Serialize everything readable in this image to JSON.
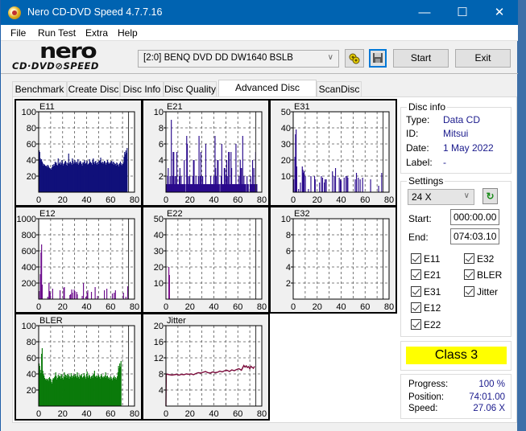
{
  "window": {
    "title": "Nero CD-DVD Speed 4.7.7.16",
    "controls": {
      "minimize": "—",
      "maximize": "☐",
      "close": "✕"
    }
  },
  "menu": [
    "File",
    "Run Test",
    "Extra",
    "Help"
  ],
  "toolbar": {
    "logo_top": "nero",
    "logo_bottom": "CD·DVD⊘SPEED",
    "drive": "[2:0]   BENQ DVD DD DW1640 BSLB",
    "start_label": "Start",
    "exit_label": "Exit"
  },
  "tabs": [
    {
      "label": "Benchmark",
      "active": false
    },
    {
      "label": "Create Disc",
      "active": false
    },
    {
      "label": "Disc Info",
      "active": false
    },
    {
      "label": "Disc Quality",
      "active": false
    },
    {
      "label": "Advanced Disc Quality",
      "active": true
    },
    {
      "label": "ScanDisc",
      "active": false
    }
  ],
  "disc_info": {
    "heading": "Disc info",
    "rows": [
      {
        "label": "Type:",
        "value": "Data CD"
      },
      {
        "label": "ID:",
        "value": "Mitsui"
      },
      {
        "label": "Date:",
        "value": "1 May 2022"
      },
      {
        "label": "Label:",
        "value": "-"
      }
    ]
  },
  "settings": {
    "heading": "Settings",
    "speed": "24 X",
    "start_label": "Start:",
    "start_value": "000:00.00",
    "end_label": "End:",
    "end_value": "074:03.10",
    "checkboxes": [
      {
        "label": "E11",
        "checked": true
      },
      {
        "label": "E32",
        "checked": true
      },
      {
        "label": "E21",
        "checked": true
      },
      {
        "label": "BLER",
        "checked": true
      },
      {
        "label": "E31",
        "checked": true
      },
      {
        "label": "Jitter",
        "checked": true
      },
      {
        "label": "E12",
        "checked": true
      },
      {
        "label": "E22",
        "checked": true
      }
    ]
  },
  "result": {
    "class_label": "Class 3",
    "class_color": "#ffff00"
  },
  "status": {
    "progress_label": "Progress:",
    "progress_value": "100 %",
    "position_label": "Position:",
    "position_value": "74:01.00",
    "speed_label": "Speed:",
    "speed_value": "27.06 X"
  },
  "chart_data": [
    {
      "name": "E11",
      "type": "bar",
      "color": "#10107a",
      "ylim": [
        0,
        100
      ],
      "yticks": [
        20,
        40,
        60,
        80,
        100
      ],
      "xlim": [
        0,
        80
      ],
      "xticks": [
        0,
        20,
        40,
        60,
        80
      ],
      "end_marker": 75,
      "values": [
        52,
        50,
        42,
        40,
        41,
        38,
        36,
        33,
        35,
        34,
        33,
        32,
        33,
        31,
        34,
        33,
        31,
        30,
        29,
        30,
        28,
        31,
        34,
        32,
        35,
        33,
        38,
        36,
        37,
        34,
        33,
        42,
        35,
        36,
        38,
        34,
        36,
        40,
        37,
        33,
        35,
        36,
        38,
        39,
        34,
        37,
        33,
        36,
        48,
        35,
        37,
        38,
        36,
        34,
        42,
        39,
        35,
        37,
        40,
        36,
        38,
        37,
        35,
        41,
        34,
        36,
        38,
        39,
        37,
        35,
        33,
        37,
        36,
        38,
        40,
        35,
        36,
        37,
        39,
        34,
        35,
        36,
        41,
        38,
        37,
        36,
        34,
        40,
        42,
        37,
        35,
        38,
        39,
        36,
        34,
        37,
        38,
        35,
        39,
        40,
        43,
        37,
        36,
        38,
        35,
        37,
        39,
        38,
        36,
        34,
        37,
        40,
        38,
        36,
        35,
        37,
        36,
        38,
        39,
        35,
        37,
        38,
        34,
        36,
        35,
        33,
        37,
        36,
        34,
        32,
        35,
        36,
        38,
        34,
        36,
        33,
        35,
        37,
        44,
        50,
        47,
        52,
        49,
        55
      ]
    },
    {
      "name": "E21",
      "type": "bar",
      "color": "#2a0a8c",
      "ylim": [
        0,
        10
      ],
      "yticks": [
        2,
        4,
        6,
        8,
        10
      ],
      "xlim": [
        0,
        80
      ],
      "xticks": [
        0,
        20,
        40,
        60,
        80
      ],
      "end_marker": 75,
      "values": [
        1,
        1,
        2,
        3,
        1,
        1,
        2,
        1,
        9,
        1,
        2,
        5,
        5,
        1,
        2,
        1,
        2,
        5,
        1,
        1,
        1,
        2,
        3,
        1,
        2,
        1,
        1,
        1,
        1,
        4,
        1,
        0,
        1,
        7,
        6,
        1,
        2,
        1,
        2,
        1,
        1,
        1,
        1,
        2,
        4,
        4,
        1,
        1,
        2,
        1,
        1,
        1,
        2,
        7,
        1,
        2,
        5,
        1,
        2,
        2,
        1,
        1,
        1,
        1,
        6,
        1,
        1,
        1,
        1,
        1,
        1,
        1,
        2,
        1,
        1,
        1,
        1,
        2,
        1,
        7,
        3,
        2,
        1,
        4,
        4,
        1,
        1,
        0,
        1,
        2,
        6,
        1,
        1,
        1,
        3,
        3,
        1,
        2,
        4,
        2,
        1,
        5,
        5,
        1,
        1,
        5,
        3,
        1,
        1,
        1,
        1,
        1,
        1,
        6,
        1,
        1,
        1,
        1,
        2,
        1,
        4,
        3,
        3,
        1,
        7,
        1,
        2,
        1,
        1,
        1,
        0,
        2,
        1,
        1,
        0,
        0,
        1,
        2,
        1,
        1,
        4,
        1,
        3,
        1,
        1,
        5,
        1,
        1
      ]
    },
    {
      "name": "E31",
      "type": "bar",
      "color": "#2a0a8c",
      "ylim": [
        0,
        50
      ],
      "yticks": [
        10,
        20,
        30,
        40,
        50
      ],
      "xlim": [
        0,
        80
      ],
      "xticks": [
        0,
        20,
        40,
        60,
        80
      ],
      "end_marker": 75,
      "values": [
        8,
        0,
        22,
        36,
        39,
        16,
        0,
        0,
        2,
        0,
        0,
        6,
        0,
        0,
        16,
        14,
        12,
        13,
        0,
        10,
        0,
        0,
        0,
        0,
        2,
        0,
        0,
        0,
        10,
        0,
        0,
        0,
        0,
        0,
        10,
        8,
        0,
        0,
        0,
        0,
        0,
        0,
        6,
        0,
        0,
        10,
        0,
        9,
        0,
        0,
        6,
        8,
        0,
        8,
        0,
        0,
        0,
        0,
        0,
        0,
        0,
        0,
        0,
        13,
        0,
        0,
        10,
        0,
        15,
        0,
        0,
        0,
        0,
        0,
        9,
        0,
        8,
        7,
        0,
        0,
        0,
        0,
        9,
        0,
        0,
        10,
        0,
        10,
        9,
        0,
        0,
        0,
        0,
        0,
        0,
        0,
        0,
        0,
        0,
        0,
        8,
        0,
        12,
        0,
        0,
        9,
        0,
        0,
        8,
        0,
        0,
        0,
        9,
        0,
        0,
        0,
        0,
        0,
        0,
        0,
        0,
        0,
        0,
        0,
        0,
        8,
        0,
        0,
        0,
        0,
        0,
        0,
        0,
        0,
        0,
        0,
        0,
        0,
        4,
        0,
        0,
        0,
        0,
        12,
        0,
        0,
        0,
        0
      ]
    },
    {
      "name": "E12",
      "type": "bar",
      "color": "#6a0a8a",
      "ylim": [
        0,
        1000
      ],
      "yticks": [
        200,
        400,
        600,
        800,
        1000
      ],
      "xlim": [
        0,
        80
      ],
      "xticks": [
        0,
        20,
        40,
        60,
        80
      ],
      "end_marker": 75,
      "values": [
        100,
        0,
        310,
        580,
        680,
        180,
        0,
        0,
        0,
        0,
        0,
        0,
        0,
        0,
        30,
        0,
        200,
        100,
        80,
        0,
        0,
        0,
        130,
        0,
        0,
        0,
        0,
        0,
        0,
        0,
        0,
        0,
        0,
        0,
        110,
        0,
        0,
        0,
        0,
        0,
        140,
        150,
        0,
        0,
        0,
        0,
        0,
        0,
        0,
        0,
        50,
        60,
        0,
        120,
        80,
        0,
        0,
        120,
        100,
        0,
        0,
        90,
        60,
        0,
        0,
        0,
        0,
        0,
        0,
        0,
        40,
        0,
        200,
        0,
        0,
        0,
        30,
        0,
        80,
        110,
        0,
        0,
        0,
        0,
        0,
        90,
        0,
        0,
        0,
        0,
        0,
        150,
        0,
        0,
        0,
        40,
        0,
        0,
        0,
        0,
        0,
        0,
        0,
        0,
        0,
        0,
        110,
        0,
        0,
        0,
        130,
        0,
        0,
        0,
        0,
        0,
        0,
        0,
        0,
        70,
        0,
        0,
        80,
        0,
        110,
        0,
        0,
        0,
        0,
        0,
        0,
        0,
        0,
        0,
        0,
        0,
        0,
        80,
        0,
        0,
        0,
        30,
        0,
        0,
        160,
        0,
        0,
        0
      ]
    },
    {
      "name": "E22",
      "type": "bar",
      "color": "#7a0a8a",
      "ylim": [
        0,
        50
      ],
      "yticks": [
        10,
        20,
        30,
        40,
        50
      ],
      "xlim": [
        0,
        80
      ],
      "xticks": [
        0,
        20,
        40,
        60,
        80
      ],
      "end_marker": 75,
      "values": [
        0,
        0,
        0,
        0,
        20,
        15
      ]
    },
    {
      "name": "E32",
      "type": "bar",
      "color": "#2a0a8c",
      "ylim": [
        0,
        10
      ],
      "yticks": [
        2,
        4,
        6,
        8,
        10
      ],
      "xlim": [
        0,
        80
      ],
      "xticks": [
        0,
        20,
        40,
        60,
        80
      ],
      "end_marker": 75,
      "values": []
    },
    {
      "name": "BLER",
      "type": "bar",
      "color": "#0a7a0a",
      "ylim": [
        0,
        100
      ],
      "yticks": [
        20,
        40,
        60,
        80,
        100
      ],
      "xlim": [
        0,
        80
      ],
      "xticks": [
        0,
        20,
        40,
        60,
        80
      ],
      "end_marker": 75,
      "values": [
        53,
        50,
        45,
        41,
        65,
        72,
        44,
        40,
        38,
        35,
        33,
        34,
        32,
        34,
        33,
        31,
        35,
        36,
        34,
        33,
        30,
        28,
        33,
        35,
        34,
        36,
        38,
        42,
        37,
        33,
        35,
        39,
        36,
        38,
        37,
        34,
        40,
        38,
        35,
        33,
        37,
        42,
        36,
        39,
        38,
        35,
        40,
        37,
        39,
        34,
        37,
        36,
        41,
        38,
        35,
        37,
        39,
        36,
        38,
        40,
        37,
        35,
        42,
        38,
        36,
        34,
        39,
        37,
        38,
        40,
        36,
        35,
        37,
        41,
        38,
        36,
        34,
        40,
        43,
        37,
        35,
        39,
        38,
        36,
        34,
        37,
        38,
        35,
        39,
        40,
        44,
        37,
        36,
        38,
        35,
        37,
        39,
        38,
        36,
        34,
        37,
        40,
        38,
        36,
        35,
        37,
        36,
        38,
        42,
        35,
        37,
        38,
        34,
        36,
        35,
        33,
        37,
        36,
        34,
        32,
        35,
        36,
        38,
        34,
        36,
        33,
        35,
        37,
        42,
        50,
        47,
        53,
        49,
        56
      ]
    },
    {
      "name": "Jitter",
      "type": "line",
      "color": "#7a0a3a",
      "ylim": [
        0,
        20
      ],
      "yticks": [
        4,
        8,
        12,
        16,
        20
      ],
      "xlim": [
        0,
        80
      ],
      "xticks": [
        0,
        20,
        40,
        60,
        80
      ],
      "end_marker": 75,
      "x": [
        0,
        0.3,
        1,
        3,
        5,
        7,
        9,
        11,
        13,
        15,
        17,
        19,
        21,
        23,
        25,
        27,
        29,
        31,
        33,
        35,
        37,
        39,
        41,
        43,
        45,
        47,
        49,
        51,
        53,
        55,
        57,
        59,
        61,
        63,
        64,
        65,
        66,
        67,
        68,
        69,
        70,
        71,
        72,
        73,
        74
      ],
      "values": [
        0,
        8,
        7.9,
        7.8,
        7.7,
        7.8,
        7.9,
        7.7,
        7.9,
        7.8,
        8,
        7.9,
        8,
        7.8,
        8.1,
        8.3,
        8.2,
        8.4,
        8.6,
        8.3,
        8.2,
        8.5,
        8.3,
        8.4,
        8.7,
        8.5,
        8.8,
        8.9,
        8.6,
        9,
        8.8,
        9.1,
        9.3,
        8.9,
        9.5,
        10.1,
        9.7,
        10,
        9.6,
        9.8,
        9.3,
        9.9,
        9.6,
        9.4,
        9.9
      ]
    }
  ]
}
